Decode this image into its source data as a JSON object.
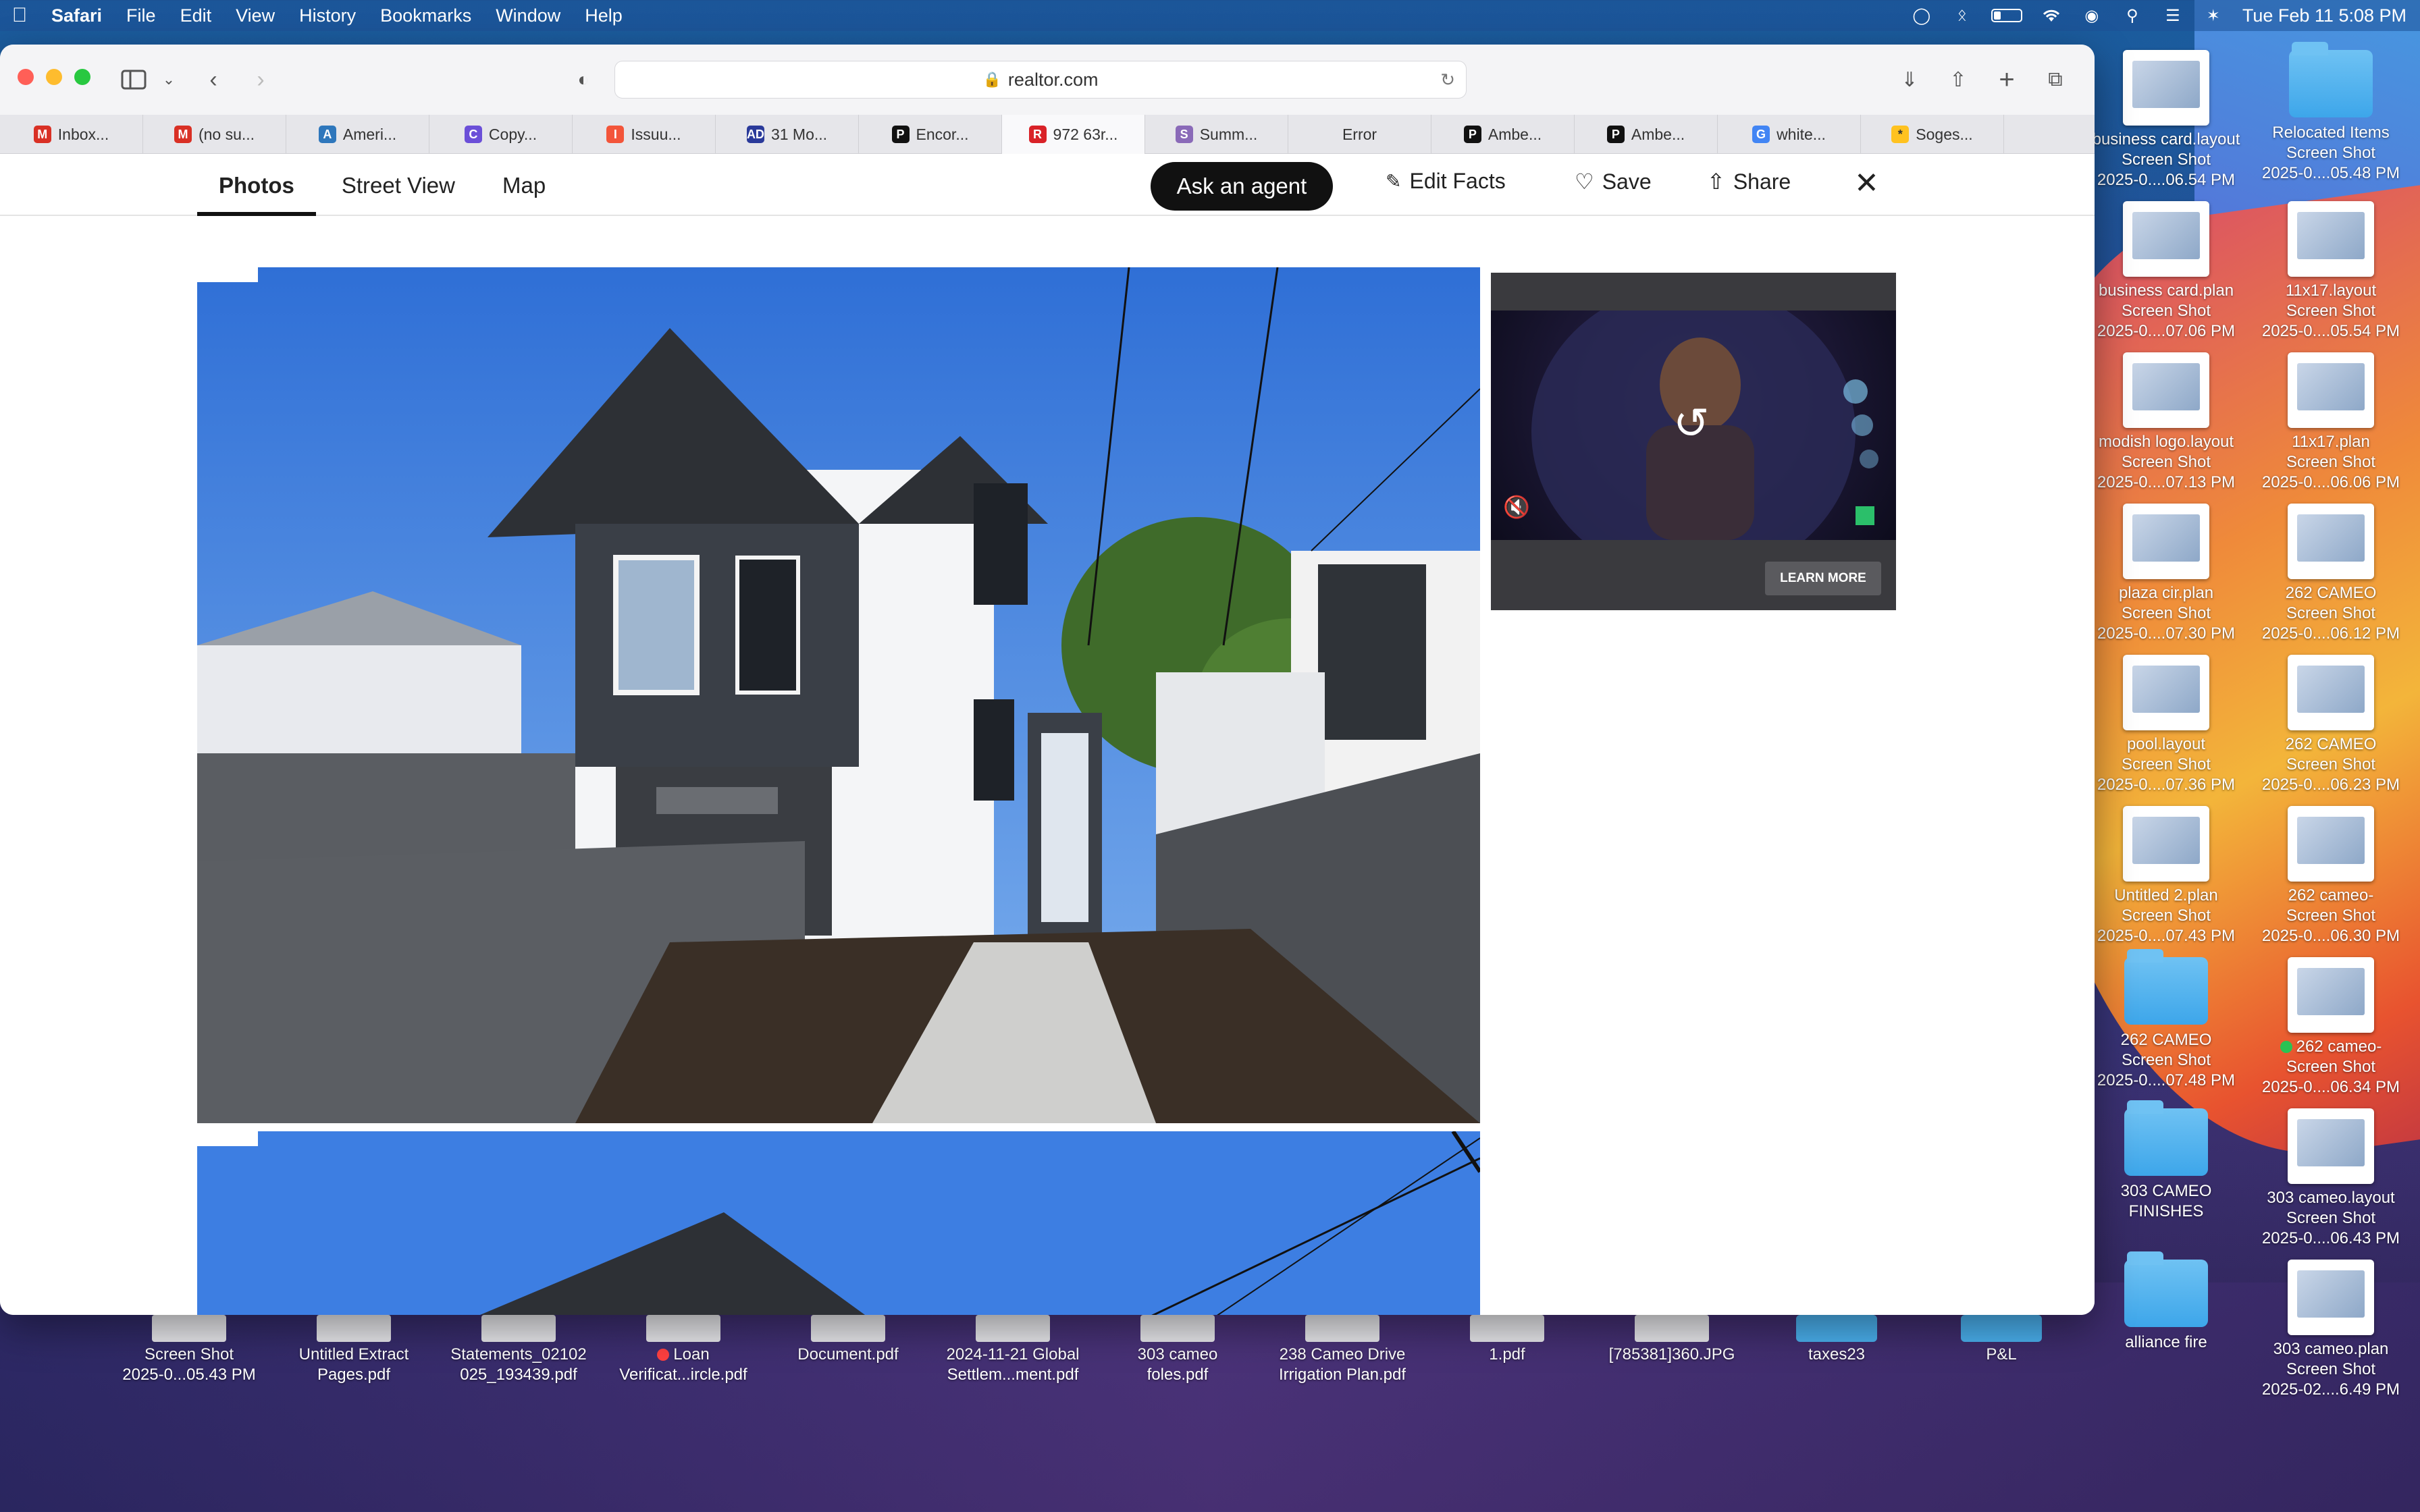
{
  "menubar": {
    "app": "Safari",
    "items": [
      "File",
      "Edit",
      "View",
      "History",
      "Bookmarks",
      "Window",
      "Help"
    ],
    "clock": "Tue Feb 11  5:08 PM"
  },
  "browser": {
    "url": "realtor.com",
    "tabs": [
      {
        "label": "Inbox...",
        "icon": "gmail-icon",
        "color": "#d93025",
        "glyph": "M"
      },
      {
        "label": "(no su...",
        "icon": "gmail-icon",
        "color": "#d93025",
        "glyph": "M"
      },
      {
        "label": "Ameri...",
        "icon": "amex-icon",
        "color": "#2e77bc",
        "glyph": "A"
      },
      {
        "label": "Copy...",
        "icon": "copy-icon",
        "color": "#6b4fd8",
        "glyph": "C"
      },
      {
        "label": "Issuu...",
        "icon": "issuu-icon",
        "color": "#f3553a",
        "glyph": "I"
      },
      {
        "label": "31 Mo...",
        "icon": "ad-icon",
        "color": "#2a3a9a",
        "glyph": "AD"
      },
      {
        "label": "Encor...",
        "icon": "pinterest-icon",
        "color": "#111111",
        "glyph": "P"
      },
      {
        "label": "972 63r...",
        "icon": "realtor-icon",
        "color": "#d92228",
        "glyph": "R"
      },
      {
        "label": "Summ...",
        "icon": "script-icon",
        "color": "#8a6ab8",
        "glyph": "S"
      },
      {
        "label": "Error",
        "icon": "none",
        "color": "#ffffff",
        "glyph": ""
      },
      {
        "label": "Ambe...",
        "icon": "p-icon",
        "color": "#111111",
        "glyph": "P"
      },
      {
        "label": "Ambe...",
        "icon": "p-icon",
        "color": "#111111",
        "glyph": "P"
      },
      {
        "label": "white...",
        "icon": "google-icon",
        "color": "#4285f4",
        "glyph": "G"
      },
      {
        "label": "Soges...",
        "icon": "walmart-icon",
        "color": "#ffc220",
        "glyph": "*"
      }
    ],
    "active_tab": 7
  },
  "page": {
    "tabs": [
      "Photos",
      "Street View",
      "Map"
    ],
    "active_tab": "Photos",
    "ask_agent": "Ask an agent",
    "edit_facts": "Edit Facts",
    "save": "Save",
    "share": "Share",
    "ad": {
      "learn_more": "LEARN MORE"
    }
  },
  "desktop": {
    "right_icons": [
      {
        "label": "business card.layout",
        "sub": "Screen Shot",
        "sub2": "2025-0....06.54 PM",
        "kind": "thumb"
      },
      {
        "label": "Relocated Items",
        "sub": "Screen Shot",
        "sub2": "2025-0....05.48 PM",
        "kind": "folder"
      },
      {
        "label": "business card.plan",
        "sub": "Screen Shot",
        "sub2": "2025-0....07.06 PM",
        "kind": "thumb"
      },
      {
        "label": "11x17.layout",
        "sub": "Screen Shot",
        "sub2": "2025-0....05.54 PM",
        "kind": "thumb"
      },
      {
        "label": "modish logo.layout",
        "sub": "Screen Shot",
        "sub2": "2025-0....07.13 PM",
        "kind": "thumb"
      },
      {
        "label": "11x17.plan",
        "sub": "Screen Shot",
        "sub2": "2025-0....06.06 PM",
        "kind": "thumb"
      },
      {
        "label": "plaza cir.plan",
        "sub": "Screen Shot",
        "sub2": "2025-0....07.30 PM",
        "kind": "thumb"
      },
      {
        "label": "262 CAMEO",
        "sub": "Screen Shot",
        "sub2": "2025-0....06.12 PM",
        "kind": "thumb"
      },
      {
        "label": "pool.layout",
        "sub": "Screen Shot",
        "sub2": "2025-0....07.36 PM",
        "kind": "thumb"
      },
      {
        "label": "262 CAMEO",
        "sub": "Screen Shot",
        "sub2": "2025-0....06.23 PM",
        "kind": "thumb"
      },
      {
        "label": "Untitled 2.plan",
        "sub": "Screen Shot",
        "sub2": "2025-0....07.43 PM",
        "kind": "thumb"
      },
      {
        "label": "262 cameo-",
        "sub": "Screen Shot",
        "sub2": "2025-0....06.30 PM",
        "kind": "thumb"
      },
      {
        "label": "262 CAMEO",
        "sub": "Screen Shot",
        "sub2": "2025-0....07.48 PM",
        "kind": "folder"
      },
      {
        "label": "262 cameo-",
        "sub": "Screen Shot",
        "sub2": "2025-0....06.34 PM",
        "kind": "thumb",
        "dot": "green"
      },
      {
        "label": "303 CAMEO",
        "sub": "FINISHES",
        "sub2": "",
        "kind": "folder"
      },
      {
        "label": "303 cameo.layout",
        "sub": "Screen Shot",
        "sub2": "2025-0....06.43 PM",
        "kind": "thumb"
      },
      {
        "label": "alliance fire",
        "sub": "",
        "sub2": "",
        "kind": "folder"
      },
      {
        "label": "303 cameo.plan",
        "sub": "Screen Shot",
        "sub2": "2025-02....6.49 PM",
        "kind": "thumb"
      }
    ],
    "bottom_icons": [
      {
        "label": "Screen Shot",
        "sub": "2025-0...05.43 PM",
        "kind": "thumb"
      },
      {
        "label": "Untitled Extract",
        "sub": "Pages.pdf",
        "kind": "thumb"
      },
      {
        "label": "Statements_02102",
        "sub": "025_193439.pdf",
        "kind": "thumb"
      },
      {
        "label": "Loan",
        "sub": "Verificat...ircle.pdf",
        "kind": "thumb",
        "dot": "red"
      },
      {
        "label": "Document.pdf",
        "sub": "",
        "kind": "thumb"
      },
      {
        "label": "2024-11-21 Global",
        "sub": "Settlem...ment.pdf",
        "kind": "thumb"
      },
      {
        "label": "303 cameo",
        "sub": "foles.pdf",
        "kind": "thumb"
      },
      {
        "label": "238 Cameo Drive",
        "sub": "Irrigation Plan.pdf",
        "kind": "thumb"
      },
      {
        "label": "1.pdf",
        "sub": "",
        "kind": "thumb"
      },
      {
        "label": "[785381]360.JPG",
        "sub": "",
        "kind": "thumb"
      },
      {
        "label": "taxes23",
        "sub": "",
        "kind": "folder"
      },
      {
        "label": "P&L",
        "sub": "",
        "kind": "folder"
      }
    ]
  }
}
